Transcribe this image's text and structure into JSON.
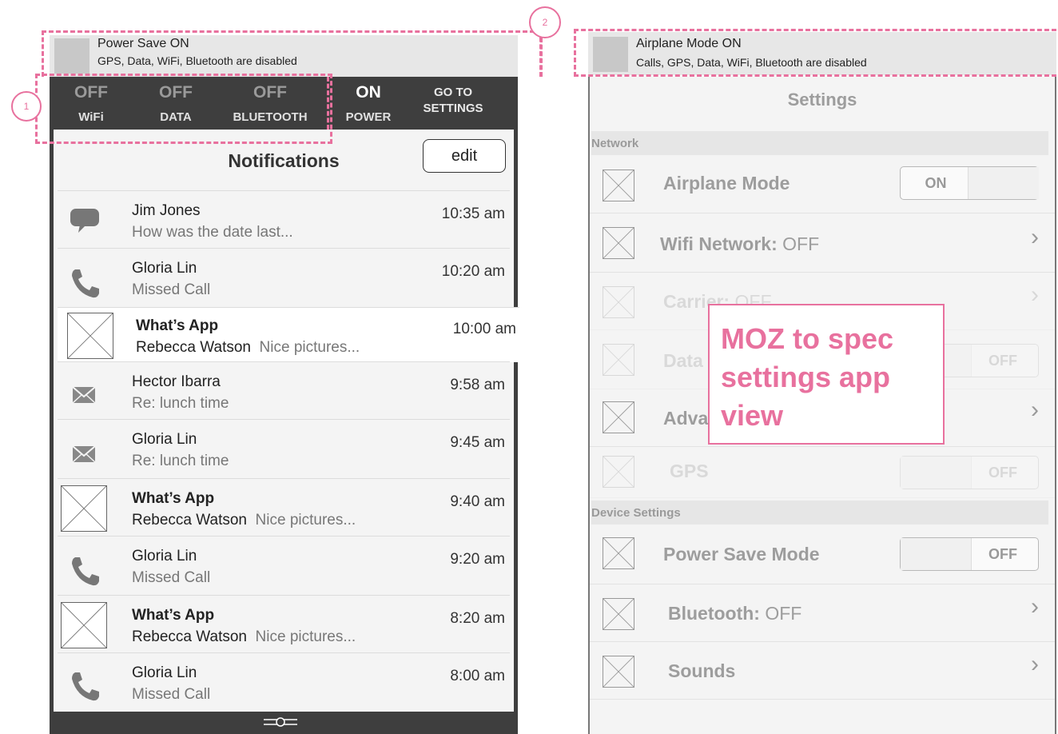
{
  "annotations": {
    "marker_1": "1",
    "marker_2": "2"
  },
  "left_banner": {
    "title": "Power Save ON",
    "subtitle": "GPS, Data, WiFi, Bluetooth are disabled"
  },
  "right_banner": {
    "title": "Airplane Mode ON",
    "subtitle": "Calls, GPS, Data, WiFi, Bluetooth are disabled"
  },
  "quick_settings": {
    "items": [
      {
        "state": "OFF",
        "label": "WiFi"
      },
      {
        "state": "OFF",
        "label": "DATA"
      },
      {
        "state": "OFF",
        "label": "BLUETOOTH"
      },
      {
        "state": "ON",
        "label": "POWER"
      }
    ],
    "goto_line1": "GO TO",
    "goto_line2": "SETTINGS"
  },
  "notifications": {
    "title": "Notifications",
    "edit_label": "edit",
    "items": [
      {
        "icon": "chat-bubble-icon",
        "name": "Jim Jones",
        "sub": "How was the date last...",
        "time": "10:35 am"
      },
      {
        "icon": "phone-icon",
        "name": "Gloria Lin",
        "sub": "Missed Call",
        "time": "10:20 am"
      },
      {
        "icon": "image-placeholder-icon",
        "name": "What’s App",
        "who": "Rebecca Watson",
        "sub": "Nice pictures...",
        "time": "10:00 am"
      },
      {
        "icon": "envelope-icon",
        "name": "Hector Ibarra",
        "sub": "Re: lunch time",
        "time": "9:58 am"
      },
      {
        "icon": "envelope-icon",
        "name": "Gloria Lin",
        "sub": "Re: lunch time",
        "time": "9:45 am"
      },
      {
        "icon": "image-placeholder-icon",
        "name": "What’s App",
        "who": "Rebecca Watson",
        "sub": "Nice pictures...",
        "time": "9:40 am"
      },
      {
        "icon": "phone-icon",
        "name": "Gloria Lin",
        "sub": "Missed Call",
        "time": "9:20 am"
      },
      {
        "icon": "image-placeholder-icon",
        "name": "What’s App",
        "who": "Rebecca Watson",
        "sub": "Nice pictures...",
        "time": "8:20 am"
      },
      {
        "icon": "phone-icon",
        "name": "Gloria Lin",
        "sub": "Missed Call",
        "time": "8:00 am"
      }
    ]
  },
  "settings": {
    "title": "Settings",
    "section_network": "Network",
    "section_device": "Device Settings",
    "airplane": {
      "label": "Airplane Mode",
      "toggle": "ON"
    },
    "wifi": {
      "label": "Wifi Network:",
      "value": "OFF"
    },
    "carrier": {
      "label": "Carrier:",
      "value": "OFF"
    },
    "data": {
      "label": "Data",
      "toggle": "OFF"
    },
    "advanced": {
      "label": "Adva"
    },
    "gps": {
      "label": "GPS",
      "toggle": "OFF"
    },
    "power_save": {
      "label": "Power Save Mode",
      "toggle": "OFF"
    },
    "bluetooth": {
      "label": "Bluetooth:",
      "value": "OFF"
    },
    "sounds": {
      "label": "Sounds"
    },
    "chevron": "›"
  },
  "sticky_note": {
    "line1": "MOZ to spec",
    "line2": "settings app",
    "line3": "view"
  },
  "colors": {
    "annotation_pink": "#e8719e",
    "dark_bar": "#3e3e3e"
  }
}
